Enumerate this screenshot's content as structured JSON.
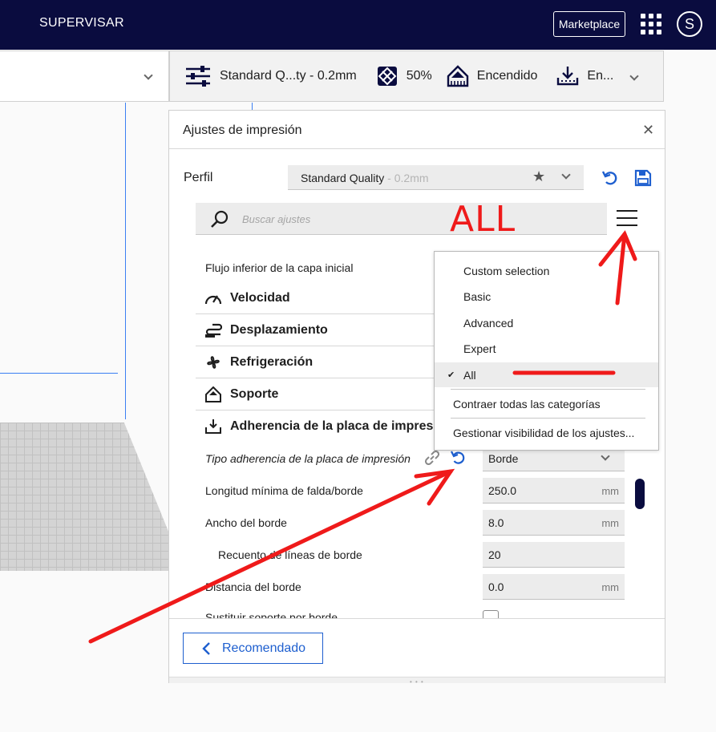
{
  "header": {
    "title": "SUPERVISAR",
    "marketplace_label": "Marketplace",
    "avatar_initial": "S"
  },
  "setup_bar": {
    "profile": "Standard Q...ty - 0.2mm",
    "infill": "50%",
    "support": "Encendido",
    "adhesion": "En..."
  },
  "panel": {
    "title": "Ajustes de impresión",
    "profile_label": "Perfil",
    "profile_name": "Standard Quality",
    "profile_layer": " - 0.2mm",
    "search_placeholder": "Buscar ajustes",
    "rows": {
      "flow": "Flujo inferior de la capa inicial",
      "speed": "Velocidad",
      "travel": "Desplazamiento",
      "cooling": "Refrigeración",
      "support": "Soporte",
      "adhesion": "Adherencia de la placa de impresión",
      "adhesion_type": "Tipo adherencia de la placa de impresión",
      "adhesion_type_value": "Borde",
      "skirt_min_len": "Longitud mínima de falda/borde",
      "skirt_min_len_value": "250.0",
      "brim_width": "Ancho del borde",
      "brim_width_value": "8.0",
      "brim_lines": "Recuento de líneas de borde",
      "brim_lines_value": "20",
      "brim_distance": "Distancia del borde",
      "brim_distance_value": "0.0",
      "brim_partial": "Sustituir soporte por borde",
      "unit_mm": "mm"
    },
    "recommended_label": "Recomendado"
  },
  "visibility_menu": {
    "items": [
      "Custom selection",
      "Basic",
      "Advanced",
      "Expert",
      "All"
    ],
    "selected_index": 4,
    "collapse_label": "Contraer todas las categorías",
    "manage_label": "Gestionar visibilidad de los ajustes..."
  },
  "annotation": {
    "text": "ALL",
    "color": "#ef1a1a"
  },
  "colors": {
    "header_bg": "#0a0c3f",
    "accent_blue": "#1e5fcf"
  }
}
